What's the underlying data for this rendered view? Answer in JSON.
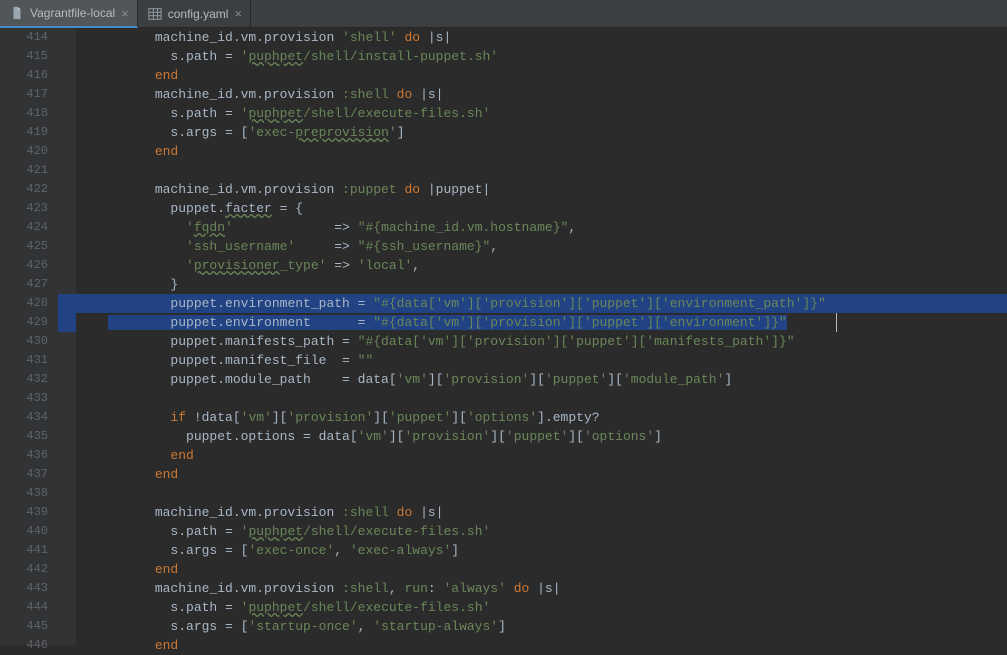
{
  "tabs": [
    {
      "label": "Vagrantfile-local",
      "icon": "file-icon",
      "active": true
    },
    {
      "label": "config.yaml",
      "icon": "yaml-icon",
      "active": false
    }
  ],
  "editor": {
    "first_line_number": 414,
    "selected_line_indices": [
      14,
      15
    ],
    "selection_end_col_chars": 95,
    "lines": [
      [
        {
          "ind": 6
        },
        {
          "t": "machine_id.vm.provision ",
          "c": "txt"
        },
        {
          "t": "'shell'",
          "c": "str"
        },
        {
          "t": " ",
          "c": "txt"
        },
        {
          "t": "do ",
          "c": "kw"
        },
        {
          "t": "|s|",
          "c": "txt"
        }
      ],
      [
        {
          "ind": 8
        },
        {
          "t": "s.path = ",
          "c": "txt"
        },
        {
          "t": "'",
          "c": "str"
        },
        {
          "t": "puphpet",
          "c": "str under"
        },
        {
          "t": "/shell/install-puppet.sh'",
          "c": "str"
        }
      ],
      [
        {
          "ind": 6
        },
        {
          "t": "end",
          "c": "kw"
        }
      ],
      [
        {
          "ind": 6
        },
        {
          "t": "machine_id.vm.provision ",
          "c": "txt"
        },
        {
          "t": ":shell",
          "c": "str"
        },
        {
          "t": " ",
          "c": "txt"
        },
        {
          "t": "do ",
          "c": "kw"
        },
        {
          "t": "|s|",
          "c": "txt"
        }
      ],
      [
        {
          "ind": 8
        },
        {
          "t": "s.path = ",
          "c": "txt"
        },
        {
          "t": "'",
          "c": "str"
        },
        {
          "t": "puphpet",
          "c": "str under"
        },
        {
          "t": "/shell/execute-files.sh'",
          "c": "str"
        }
      ],
      [
        {
          "ind": 8
        },
        {
          "t": "s.args = [",
          "c": "txt"
        },
        {
          "t": "'exec-",
          "c": "str"
        },
        {
          "t": "preprovision",
          "c": "str under"
        },
        {
          "t": "'",
          "c": "str"
        },
        {
          "t": "]",
          "c": "txt"
        }
      ],
      [
        {
          "ind": 6
        },
        {
          "t": "end",
          "c": "kw"
        }
      ],
      [
        {
          "ind": 0
        }
      ],
      [
        {
          "ind": 6
        },
        {
          "t": "machine_id.vm.provision ",
          "c": "txt"
        },
        {
          "t": ":puppet",
          "c": "str"
        },
        {
          "t": " ",
          "c": "txt"
        },
        {
          "t": "do ",
          "c": "kw"
        },
        {
          "t": "|puppet|",
          "c": "txt"
        }
      ],
      [
        {
          "ind": 8
        },
        {
          "t": "puppet.",
          "c": "txt"
        },
        {
          "t": "facter",
          "c": "txt under"
        },
        {
          "t": " = {",
          "c": "txt"
        }
      ],
      [
        {
          "ind": 10
        },
        {
          "t": "'",
          "c": "str"
        },
        {
          "t": "fqdn",
          "c": "str under"
        },
        {
          "t": "'",
          "c": "str"
        },
        {
          "t": "             => ",
          "c": "txt"
        },
        {
          "t": "\"#{machine_id.vm.hostname}\"",
          "c": "str"
        },
        {
          "t": ",",
          "c": "txt"
        }
      ],
      [
        {
          "ind": 10
        },
        {
          "t": "'ssh_username'",
          "c": "str"
        },
        {
          "t": "     => ",
          "c": "txt"
        },
        {
          "t": "\"#{ssh_username}\"",
          "c": "str"
        },
        {
          "t": ",",
          "c": "txt"
        }
      ],
      [
        {
          "ind": 10
        },
        {
          "t": "'",
          "c": "str"
        },
        {
          "t": "provisioner",
          "c": "str under"
        },
        {
          "t": "_type'",
          "c": "str"
        },
        {
          "t": " => ",
          "c": "txt"
        },
        {
          "t": "'local'",
          "c": "str"
        },
        {
          "t": ",",
          "c": "txt"
        }
      ],
      [
        {
          "ind": 8
        },
        {
          "t": "}",
          "c": "txt"
        }
      ],
      [
        {
          "ind": 8
        },
        {
          "t": "puppet.environment_path = ",
          "c": "txt"
        },
        {
          "t": "\"#{data['vm']['provision']['puppet']['environment_path']}\"",
          "c": "str"
        }
      ],
      [
        {
          "ind": 8
        },
        {
          "t": "puppet.environment      = ",
          "c": "txt"
        },
        {
          "t": "\"#{data['vm']['provision']['puppet']['environment']}\"",
          "c": "str"
        }
      ],
      [
        {
          "ind": 8
        },
        {
          "t": "puppet.manifests_path = ",
          "c": "txt"
        },
        {
          "t": "\"#{data['vm']['provision']['puppet']['manifests_path']}\"",
          "c": "str"
        }
      ],
      [
        {
          "ind": 8
        },
        {
          "t": "puppet.manifest_file  = ",
          "c": "txt"
        },
        {
          "t": "\"\"",
          "c": "str"
        }
      ],
      [
        {
          "ind": 8
        },
        {
          "t": "puppet.module_path    = data[",
          "c": "txt"
        },
        {
          "t": "'vm'",
          "c": "str"
        },
        {
          "t": "][",
          "c": "txt"
        },
        {
          "t": "'provision'",
          "c": "str"
        },
        {
          "t": "][",
          "c": "txt"
        },
        {
          "t": "'puppet'",
          "c": "str"
        },
        {
          "t": "][",
          "c": "txt"
        },
        {
          "t": "'module_path'",
          "c": "str"
        },
        {
          "t": "]",
          "c": "txt"
        }
      ],
      [
        {
          "ind": 0
        }
      ],
      [
        {
          "ind": 8
        },
        {
          "t": "if ",
          "c": "kw"
        },
        {
          "t": "!data[",
          "c": "txt"
        },
        {
          "t": "'vm'",
          "c": "str"
        },
        {
          "t": "][",
          "c": "txt"
        },
        {
          "t": "'provision'",
          "c": "str"
        },
        {
          "t": "][",
          "c": "txt"
        },
        {
          "t": "'puppet'",
          "c": "str"
        },
        {
          "t": "][",
          "c": "txt"
        },
        {
          "t": "'options'",
          "c": "str"
        },
        {
          "t": "].empty?",
          "c": "txt"
        }
      ],
      [
        {
          "ind": 10
        },
        {
          "t": "puppet.options = data[",
          "c": "txt"
        },
        {
          "t": "'vm'",
          "c": "str"
        },
        {
          "t": "][",
          "c": "txt"
        },
        {
          "t": "'provision'",
          "c": "str"
        },
        {
          "t": "][",
          "c": "txt"
        },
        {
          "t": "'puppet'",
          "c": "str"
        },
        {
          "t": "][",
          "c": "txt"
        },
        {
          "t": "'options'",
          "c": "str"
        },
        {
          "t": "]",
          "c": "txt"
        }
      ],
      [
        {
          "ind": 8
        },
        {
          "t": "end",
          "c": "kw"
        }
      ],
      [
        {
          "ind": 6
        },
        {
          "t": "end",
          "c": "kw"
        }
      ],
      [
        {
          "ind": 0
        }
      ],
      [
        {
          "ind": 6
        },
        {
          "t": "machine_id.vm.provision ",
          "c": "txt"
        },
        {
          "t": ":shell",
          "c": "str"
        },
        {
          "t": " ",
          "c": "txt"
        },
        {
          "t": "do ",
          "c": "kw"
        },
        {
          "t": "|s|",
          "c": "txt"
        }
      ],
      [
        {
          "ind": 8
        },
        {
          "t": "s.path = ",
          "c": "txt"
        },
        {
          "t": "'",
          "c": "str"
        },
        {
          "t": "puphpet",
          "c": "str under"
        },
        {
          "t": "/shell/execute-files.sh'",
          "c": "str"
        }
      ],
      [
        {
          "ind": 8
        },
        {
          "t": "s.args = [",
          "c": "txt"
        },
        {
          "t": "'exec-once'",
          "c": "str"
        },
        {
          "t": ", ",
          "c": "txt"
        },
        {
          "t": "'exec-always'",
          "c": "str"
        },
        {
          "t": "]",
          "c": "txt"
        }
      ],
      [
        {
          "ind": 6
        },
        {
          "t": "end",
          "c": "kw"
        }
      ],
      [
        {
          "ind": 6
        },
        {
          "t": "machine_id.vm.provision ",
          "c": "txt"
        },
        {
          "t": ":shell",
          "c": "str"
        },
        {
          "t": ", ",
          "c": "txt"
        },
        {
          "t": "run",
          "c": "str"
        },
        {
          "t": ": ",
          "c": "txt"
        },
        {
          "t": "'always'",
          "c": "str"
        },
        {
          "t": " ",
          "c": "txt"
        },
        {
          "t": "do ",
          "c": "kw"
        },
        {
          "t": "|s|",
          "c": "txt"
        }
      ],
      [
        {
          "ind": 8
        },
        {
          "t": "s.path = ",
          "c": "txt"
        },
        {
          "t": "'",
          "c": "str"
        },
        {
          "t": "puphpet",
          "c": "str under"
        },
        {
          "t": "/shell/execute-files.sh'",
          "c": "str"
        }
      ],
      [
        {
          "ind": 8
        },
        {
          "t": "s.args = [",
          "c": "txt"
        },
        {
          "t": "'startup-once'",
          "c": "str"
        },
        {
          "t": ", ",
          "c": "txt"
        },
        {
          "t": "'startup-always'",
          "c": "str"
        },
        {
          "t": "]",
          "c": "txt"
        }
      ],
      [
        {
          "ind": 6
        },
        {
          "t": "end",
          "c": "kw"
        }
      ]
    ]
  },
  "colors": {
    "background": "#2b2b2b",
    "gutter": "#313335",
    "selection": "#214283",
    "string": "#6a8759",
    "keyword": "#cc7832",
    "default": "#a9b7c6"
  }
}
